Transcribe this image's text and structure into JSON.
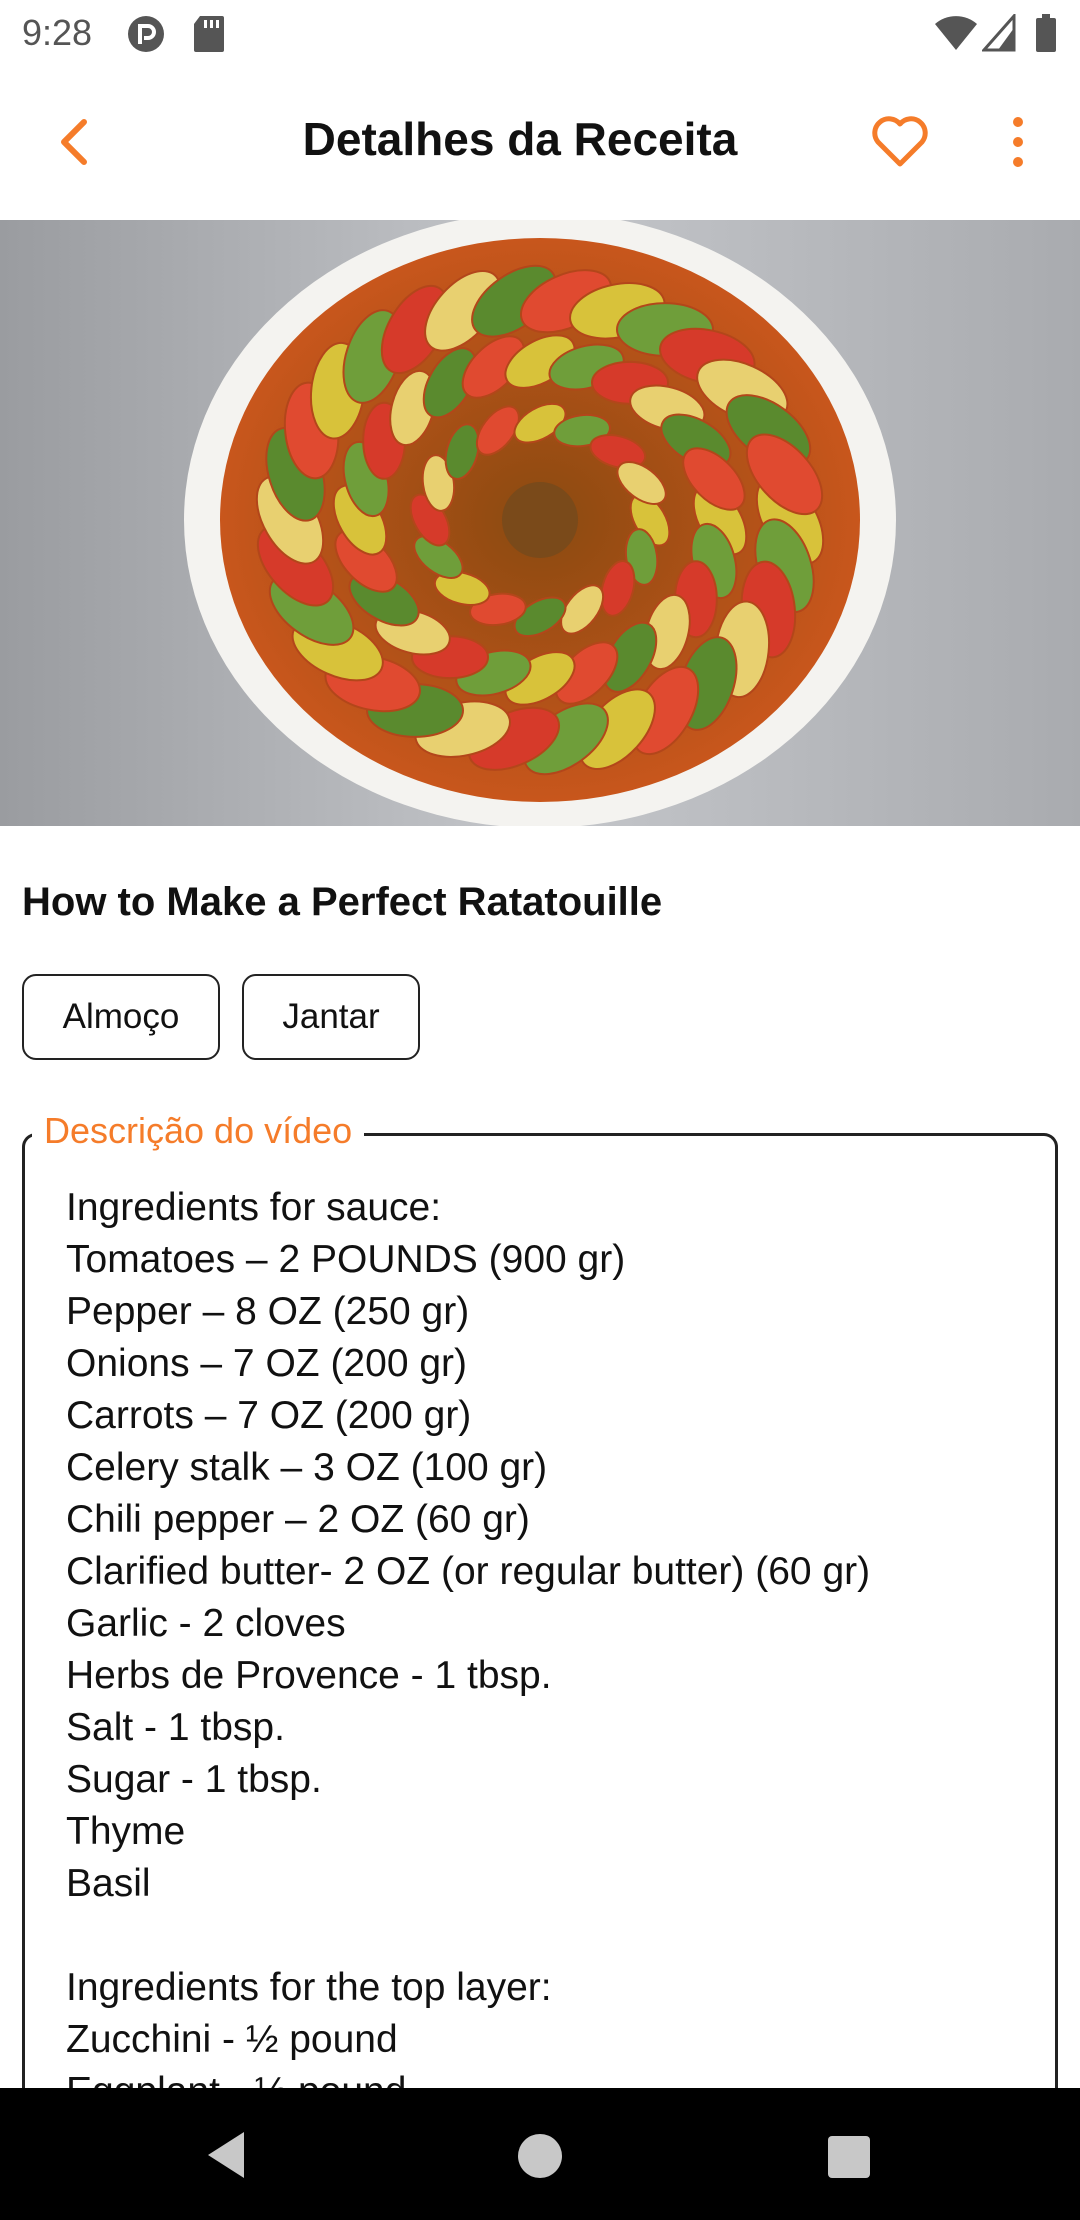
{
  "status_bar": {
    "time": "9:28",
    "icons": [
      "pocket-casts-icon",
      "sd-card-icon",
      "wifi-icon",
      "signal-icon",
      "battery-icon"
    ]
  },
  "app_bar": {
    "title": "Detalhes da Receita",
    "back_icon": "chevron-left-icon",
    "favorite_icon": "heart-outline-icon",
    "more_icon": "more-vertical-icon",
    "accent_color": "#f57c2a"
  },
  "recipe": {
    "image": "ratatouille-dish-photo",
    "title": "How to Make a Perfect Ratatouille",
    "tags": [
      "Almoço",
      "Jantar"
    ]
  },
  "description": {
    "label": "Descrição do vídeo",
    "lines": [
      "Ingredients for sauce:",
      "Tomatoes – 2 POUNDS (900 gr)",
      "Pepper – 8 OZ (250 gr)",
      "Onions – 7 OZ (200 gr)",
      "Carrots – 7 OZ (200 gr)",
      "Celery stalk – 3 OZ (100 gr)",
      "Chili pepper – 2 OZ (60 gr)",
      "Clarified butter- 2 OZ (or regular butter) (60 gr)",
      "Garlic - 2 cloves",
      "Herbs de Provence - 1 tbsp.",
      "Salt - 1 tbsp.",
      "Sugar - 1 tbsp.",
      "Thyme",
      "Basil",
      "",
      "Ingredients for the top layer:",
      "Zucchini - ½ pound",
      "Eggplant - ½ pound"
    ]
  },
  "nav_bar": {
    "icons": [
      "nav-back-icon",
      "nav-home-icon",
      "nav-recents-icon"
    ]
  }
}
